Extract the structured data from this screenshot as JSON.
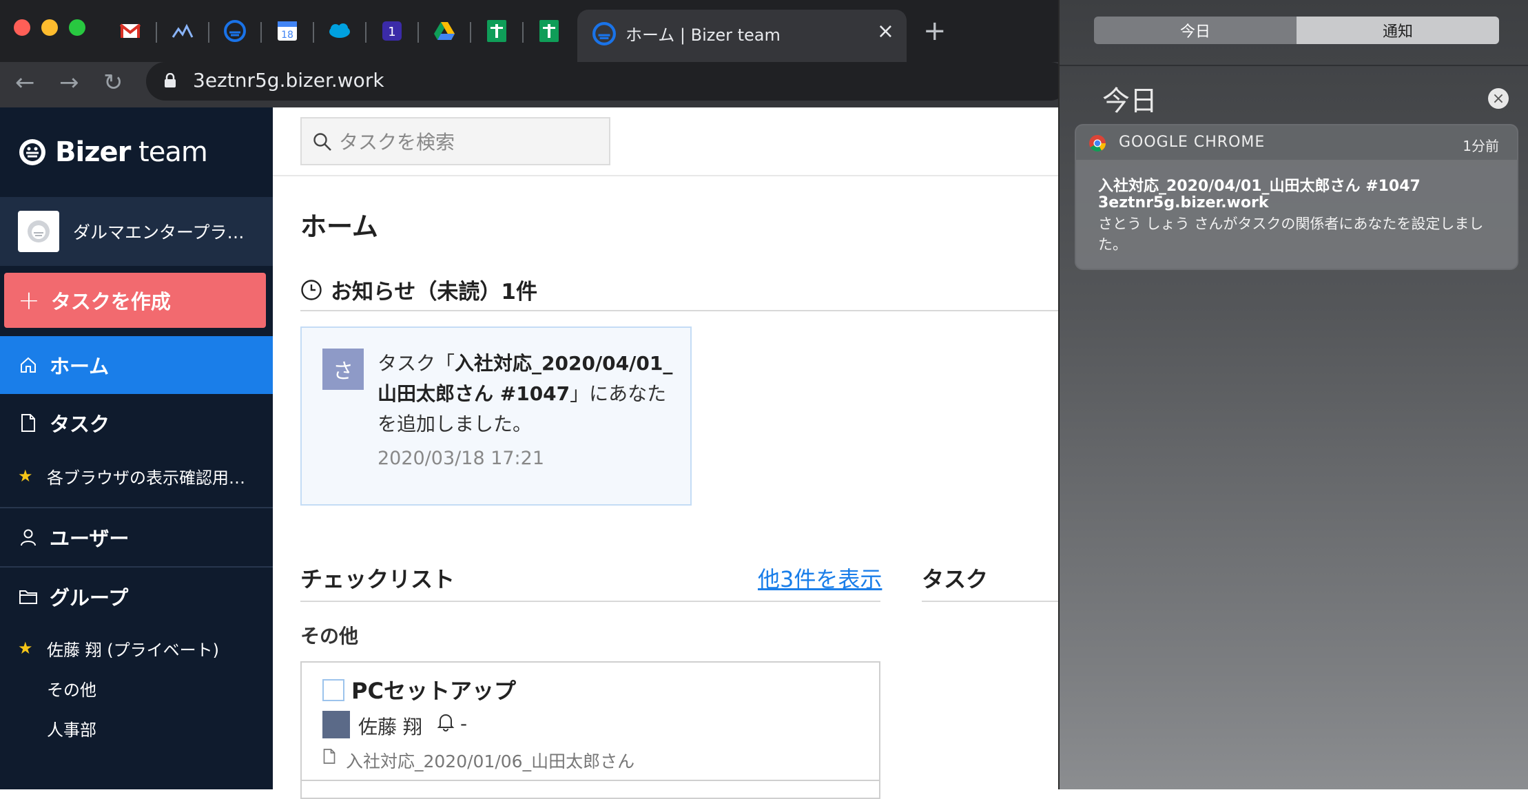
{
  "browser": {
    "tabs": [
      {
        "icon": "gmail-icon"
      },
      {
        "icon": "analytics-icon"
      },
      {
        "icon": "bizer-icon"
      },
      {
        "icon": "calendar-icon",
        "label": "18"
      },
      {
        "icon": "salesforce-icon"
      },
      {
        "icon": "onepassword-icon",
        "label": "1"
      },
      {
        "icon": "google-drive-icon"
      },
      {
        "icon": "google-sheets-icon"
      },
      {
        "icon": "google-sheets-icon"
      }
    ],
    "active_tab": {
      "title": "ホーム | Bizer team",
      "close": "×"
    },
    "new_tab": "+",
    "url": "3eztnr5g.bizer.work",
    "nav": {
      "back": "←",
      "forward": "→",
      "reload": "↻"
    }
  },
  "sidebar": {
    "brand_bold": "Bizer",
    "brand_light": " team",
    "org_name": "ダルマエンタープラ…",
    "create_task": "タスクを作成",
    "create_plus": "+",
    "home": "ホーム",
    "task": "タスク",
    "starred_project": "各ブラウザの表示確認用…",
    "users": "ユーザー",
    "groups": "グループ",
    "private_group": "佐藤 翔 (プライベート)",
    "group_other": "その他",
    "group_hr": "人事部",
    "star": "★"
  },
  "header": {
    "search_placeholder": "タスクを検索"
  },
  "main": {
    "page_title": "ホーム",
    "notice_heading": "お知らせ（未読）1件",
    "notice": {
      "avatar": "さ",
      "prefix": "タスク「",
      "task_name": "入社対応_2020/04/01_山田太郎さん #1047",
      "suffix": "」にあなたを追加しました。",
      "time": "2020/03/18 17:21"
    },
    "checklist_heading": "チェックリスト",
    "checklist_more": "他3件を表示",
    "task_heading": "タスク",
    "other_label": "その他",
    "check_item": {
      "title": "PCセットアップ",
      "assignee": "佐藤 翔",
      "reminder": "-",
      "task_ref": "入社対応_2020/01/06_山田太郎さん"
    }
  },
  "notification_center": {
    "seg_today": "今日",
    "seg_notifications": "通知",
    "title": "今日",
    "close": "×",
    "card": {
      "app": "GOOGLE CHROME",
      "ago": "1分前",
      "title": "入社対応_2020/04/01_山田太郎さん #1047",
      "subtitle": "3eztnr5g.bizer.work",
      "body": "さとう しょう さんがタスクの関係者にあなたを設定しました。"
    }
  },
  "colors": {
    "sidebar_bg": "#0f1b2d",
    "accent_blue": "#1a7ee9",
    "create_red": "#f26a6f",
    "star_yellow": "#f5c518"
  }
}
